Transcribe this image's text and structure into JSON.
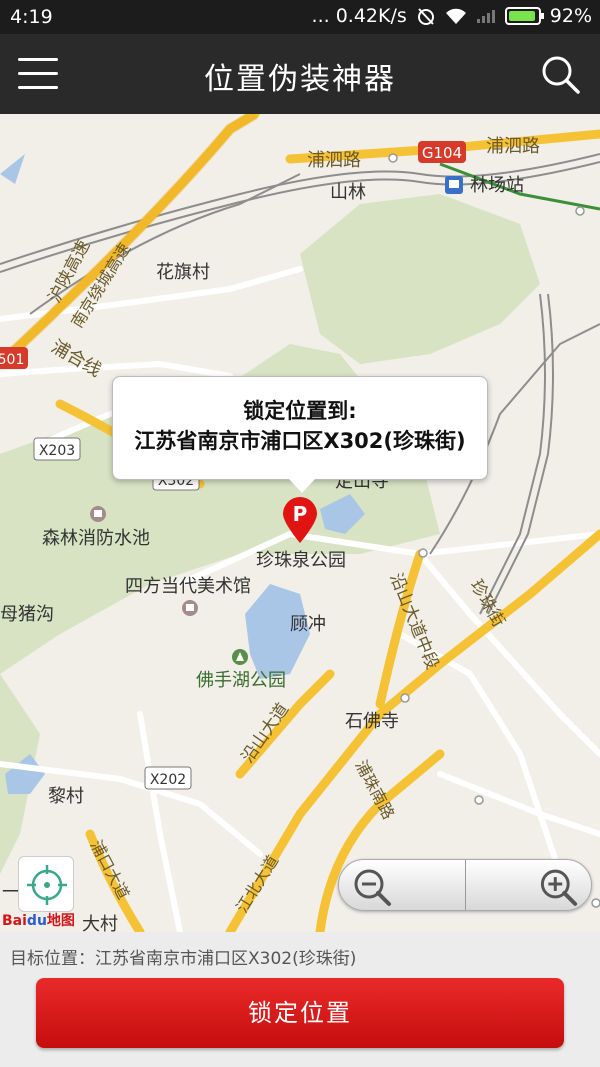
{
  "status_bar": {
    "time": "4:19",
    "network_speed": "... 0.42K/s",
    "battery_percent": "92%",
    "battery_level": 0.92
  },
  "app_bar": {
    "title": "位置伪装神器",
    "menu_icon": "hamburger-menu-icon",
    "search_icon": "search-icon"
  },
  "map": {
    "roads": {
      "pusi_road": "浦泗路",
      "pusi_road_east": "浦泗路",
      "g104": "G104",
      "x203": "X203",
      "x302": "X302",
      "x202": "X202",
      "s501": "501",
      "puhe_line": "浦合线",
      "hu_shan_expressway": "沪陕高速",
      "nanjing_ring_expressway": "南京绕城高速",
      "yanshan_avenue_middle": "沿山大道中段",
      "yanshan_avenue": "沿山大道",
      "zhenzhu_street": "珍珠街",
      "puzhu_road": "浦珠南路",
      "jiangbei_avenue": "江北大道",
      "pukou_avenue": "浦口大道"
    },
    "pois": {
      "shanlin": "山林",
      "linchang_station": "林场站",
      "huaqi_village": "花旗村",
      "dingshan_temple": "定山寺",
      "forest_pool": "森林消防水池",
      "zhenzhuquan_park": "珍珠泉公园",
      "sifang_museum": "四方当代美术馆",
      "muzhugou": "母猪沟",
      "dingchong": "顾冲",
      "foshouhu_park": "佛手湖公园",
      "shifo_temple": "石佛寺",
      "li_village": "黎村",
      "da_village": "大村",
      "edge_label": "一"
    },
    "callout": {
      "line1": "锁定位置到:",
      "line2": "江苏省南京市浦口区X302(珍珠街)"
    },
    "pin_letter": "P",
    "baidu_logo": {
      "brand": "Bai",
      "paw": "du",
      "suffix": "地图"
    },
    "locate_icon": "crosshair-locate-icon",
    "zoom_out_icon": "zoom-out-icon",
    "zoom_in_icon": "zoom-in-icon"
  },
  "footer": {
    "target_label": "目标位置：",
    "target_value": "江苏省南京市浦口区X302(珍珠街)",
    "lock_button": "锁定位置"
  },
  "colors": {
    "accent_red": "#d81e1e",
    "app_bar": "#2a2a2a",
    "highway": "#f6c235",
    "green_area": "#d7e3c3",
    "water": "#a9c6e6"
  }
}
